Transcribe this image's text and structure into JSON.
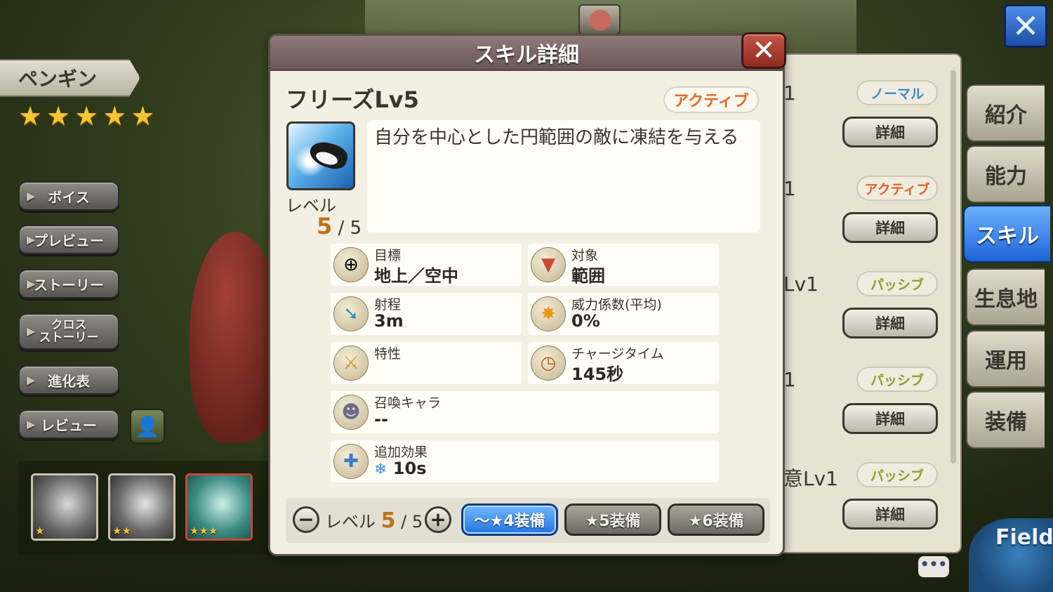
{
  "character": {
    "name": "ペンギン",
    "rarity_stars": 5,
    "star_glyph": "★"
  },
  "side_menu": [
    {
      "label": "ボイス"
    },
    {
      "label": "プレビュー"
    },
    {
      "label": "ストーリー"
    },
    {
      "label": "クロス\nストーリー"
    },
    {
      "label": "進化表"
    },
    {
      "label": "レビュー"
    }
  ],
  "thumbnails": [
    {
      "stars": "★",
      "color": "#5c5c5c"
    },
    {
      "stars": "★★",
      "color": "#5c5c5c"
    },
    {
      "stars": "★★★",
      "color": "#3e8e86"
    }
  ],
  "right_tabs": [
    {
      "label": "紹介",
      "active": false
    },
    {
      "label": "能力",
      "active": false
    },
    {
      "label": "スキル",
      "active": true
    },
    {
      "label": "生息地",
      "active": false
    },
    {
      "label": "運用",
      "active": false
    },
    {
      "label": "装備",
      "active": false
    }
  ],
  "background_skills": [
    {
      "name_fragment": "1",
      "type": "ノーマル",
      "type_class": "normal",
      "button": "詳細"
    },
    {
      "name_fragment": "1",
      "type": "アクティブ",
      "type_class": "active",
      "button": "詳細"
    },
    {
      "name_fragment": "Lv1",
      "type": "パッシブ",
      "type_class": "passive",
      "button": "詳細"
    },
    {
      "name_fragment": "1",
      "type": "パッシブ",
      "type_class": "passive",
      "button": "詳細"
    },
    {
      "name_fragment": "意Lv1",
      "type": "パッシブ",
      "type_class": "passive",
      "button": "詳細"
    }
  ],
  "close_icon_glyph": "✕",
  "field_label": "Field",
  "chat_glyph": "•••",
  "modal": {
    "title": "スキル詳細",
    "close_glyph": "✕",
    "skill_name": "フリーズLv5",
    "skill_type": "アクティブ",
    "level_label": "レベル",
    "level_current": "5",
    "level_max": "/ 5",
    "description": "自分を中心とした円範囲の敵に凍結を与える",
    "stats": {
      "target": {
        "label": "目標",
        "value": "地上／空中",
        "icon": "crosshair-icon",
        "glyph": "⊕"
      },
      "scope": {
        "label": "対象",
        "value": "範囲",
        "icon": "area-target-icon",
        "glyph": "▼"
      },
      "range": {
        "label": "射程",
        "value": "3m",
        "icon": "arrow-icon",
        "glyph": "➘"
      },
      "power": {
        "label": "威力係数(平均)",
        "value": "0%",
        "icon": "explosion-icon",
        "glyph": "✸"
      },
      "trait": {
        "label": "特性",
        "value": "",
        "icon": "sword-sparkle-icon",
        "glyph": "⚔"
      },
      "charge": {
        "label": "チャージタイム",
        "value": "145秒",
        "icon": "clock-icon",
        "glyph": "◷"
      },
      "summon": {
        "label": "召喚キャラ",
        "value": "--",
        "icon": "summon-icon",
        "glyph": "☻"
      },
      "extra": {
        "label": "追加効果",
        "value": "10s",
        "icon": "sword-plus-icon",
        "glyph": "✚",
        "effect_glyph": "❄"
      }
    },
    "bottom": {
      "minus_glyph": "−",
      "plus_glyph": "+",
      "level_label": "レベル",
      "level_current": "5",
      "level_max": "/ 5",
      "equip_buttons": [
        {
          "label": "〜★4装備",
          "active": true
        },
        {
          "label": "★5装備",
          "active": false
        },
        {
          "label": "★6装備",
          "active": false
        }
      ]
    }
  }
}
